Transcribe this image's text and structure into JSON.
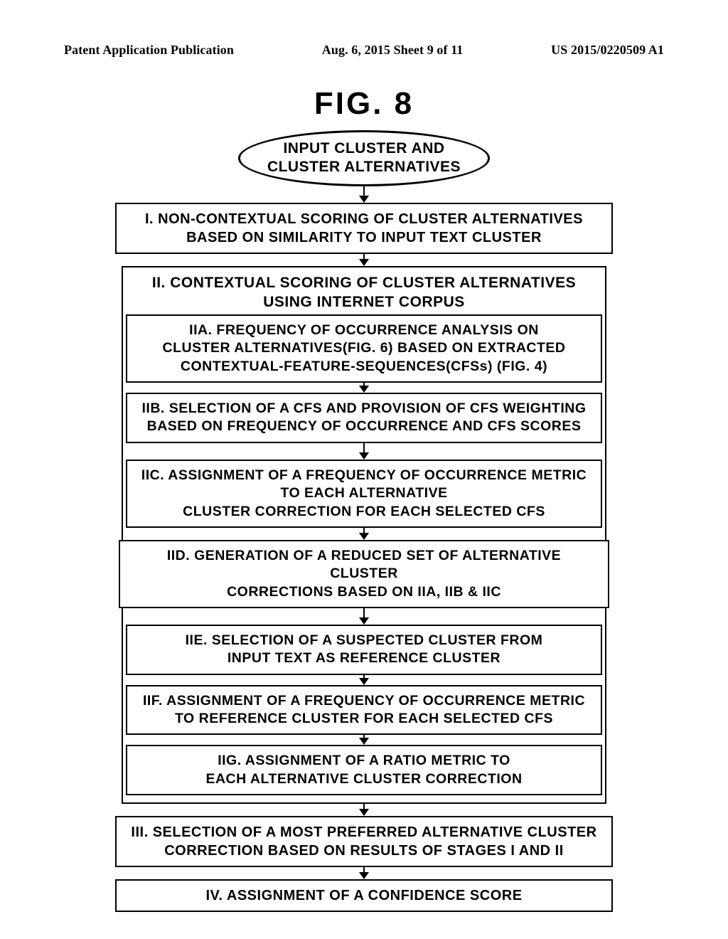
{
  "header": {
    "left": "Patent Application Publication",
    "center": "Aug. 6, 2015  Sheet 9 of 11",
    "right": "US 2015/0220509 A1"
  },
  "figure": {
    "title": "FIG.  8",
    "input": "INPUT CLUSTER AND\nCLUSTER ALTERNATIVES",
    "stage1": "I. NON-CONTEXTUAL SCORING OF CLUSTER ALTERNATIVES\nBASED ON SIMILARITY TO INPUT TEXT CLUSTER",
    "stage2": {
      "title": "II. CONTEXTUAL SCORING OF CLUSTER ALTERNATIVES\nUSING INTERNET CORPUS",
      "iia": "IIA.   FREQUENCY OF OCCURRENCE ANALYSIS ON\nCLUSTER ALTERNATIVES(FIG. 6) BASED ON EXTRACTED\nCONTEXTUAL-FEATURE-SEQUENCES(CFSs) (FIG. 4)",
      "iib": "IIB. SELECTION OF A CFS AND PROVISION OF CFS WEIGHTING\nBASED ON FREQUENCY OF OCCURRENCE AND CFS SCORES",
      "iic": "IIC. ASSIGNMENT OF A FREQUENCY OF OCCURRENCE METRIC\nTO EACH ALTERNATIVE\nCLUSTER CORRECTION FOR EACH SELECTED CFS",
      "iid": "IID. GENERATION OF A REDUCED SET OF ALTERNATIVE CLUSTER\nCORRECTIONS BASED ON IIA, IIB & IIC",
      "iie": "IIE. SELECTION OF A SUSPECTED CLUSTER FROM\nINPUT TEXT AS REFERENCE CLUSTER",
      "iif": "IIF. ASSIGNMENT OF A FREQUENCY OF OCCURRENCE METRIC\nTO REFERENCE CLUSTER FOR EACH SELECTED CFS",
      "iig": "IIG. ASSIGNMENT OF A RATIO METRIC TO\nEACH ALTERNATIVE CLUSTER CORRECTION"
    },
    "stage3": "III. SELECTION OF A MOST PREFERRED ALTERNATIVE CLUSTER\nCORRECTION BASED ON RESULTS OF STAGES I AND II",
    "stage4": "IV. ASSIGNMENT OF A CONFIDENCE SCORE"
  }
}
